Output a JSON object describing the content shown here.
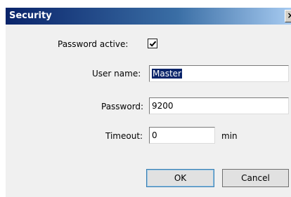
{
  "window": {
    "title": "Security",
    "close_glyph": "×"
  },
  "form": {
    "password_active_label": "Password active:",
    "password_active_checked": true,
    "username_label": "User name:",
    "username_value": "Master",
    "password_label": "Password:",
    "password_value": "9200",
    "timeout_label": "Timeout:",
    "timeout_value": "0",
    "timeout_unit": "min"
  },
  "buttons": {
    "ok_label": "OK",
    "cancel_label": "Cancel"
  },
  "icons": {
    "checkbox": "check-icon",
    "close": "close-icon"
  }
}
